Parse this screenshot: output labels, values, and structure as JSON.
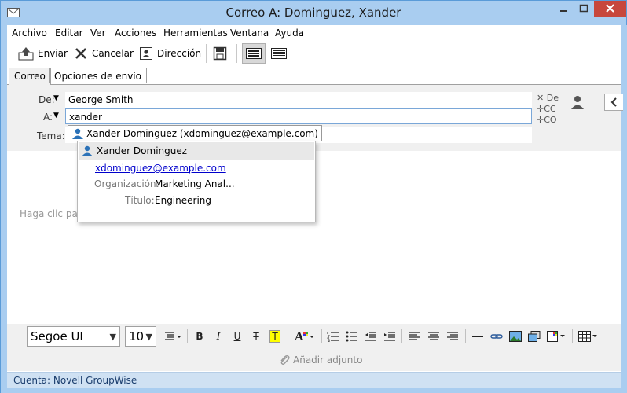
{
  "window": {
    "title": "Correo A: Dominguez, Xander",
    "controls": [
      "minimize-icon",
      "maximize-icon",
      "close-icon"
    ]
  },
  "menu": [
    "Archivo",
    "Editar",
    "Ver",
    "Acciones",
    "Herramientas",
    "Ventana",
    "Ayuda"
  ],
  "toolbar": {
    "send_label": "Enviar",
    "cancel_label": "Cancelar",
    "address_label": "Dirección"
  },
  "tabs": [
    "Correo",
    "Opciones de envío"
  ],
  "header": {
    "from_label": "De:",
    "from_value": "George Smith",
    "to_label": "A:",
    "to_value": "xander",
    "subject_label": "Tema:",
    "chip_text": "Xander Dominguez (xdominguez@example.com)",
    "actions": {
      "de": "De",
      "cc": "CC",
      "co": "CO"
    }
  },
  "popup": {
    "name": "Xander Dominguez",
    "email": "xdominguez@example.com",
    "org_label": "Organización:",
    "org_value": "Marketing Anal...",
    "title_label": "Título:",
    "title_value": "Engineering"
  },
  "body": {
    "placeholder": "Haga clic par"
  },
  "format": {
    "font": "Segoe UI",
    "size": "10"
  },
  "attach": {
    "label": "Añadir adjunto"
  },
  "status": {
    "text": "Cuenta: Novell GroupWise"
  },
  "colors": {
    "titlebar": "#a9cdf0",
    "close_button": "#c7473c",
    "link": "#0000cc",
    "status_text": "#1a3d6d"
  }
}
